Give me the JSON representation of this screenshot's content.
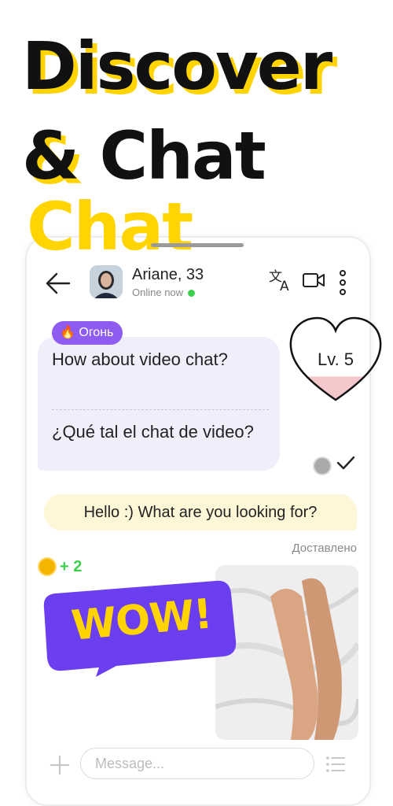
{
  "headline": {
    "line1": "Discover",
    "line2": "& Chat"
  },
  "chat": {
    "contact": {
      "name": "Ariane, 33",
      "status": "Online now"
    },
    "icons": [
      "back-arrow-icon",
      "translate-icon",
      "video-camera-icon",
      "more-vertical-icon",
      "plus-icon",
      "list-menu-icon",
      "heart-icon",
      "coin-icon",
      "check-icon"
    ],
    "level": "Lv. 5",
    "level_fill": 0.3,
    "incoming": {
      "tag": "🔥 Огонь",
      "original": "How about video chat?",
      "translated": "¿Qué tal el chat de video?"
    },
    "outgoing": {
      "text": "Hello :) What are you looking for?",
      "status": "Доставлено"
    },
    "reward": {
      "value": "+ 2"
    },
    "reaction": "WOW!",
    "input": {
      "placeholder": "Message..."
    }
  },
  "colors": {
    "accent_yellow": "#ffd400",
    "accent_purple": "#8e5cf0",
    "online_green": "#3ccf4e",
    "incoming_bg": "#f1eefb",
    "outgoing_bg": "#fdf7d8",
    "heart_fill": "#f4c7cb"
  }
}
